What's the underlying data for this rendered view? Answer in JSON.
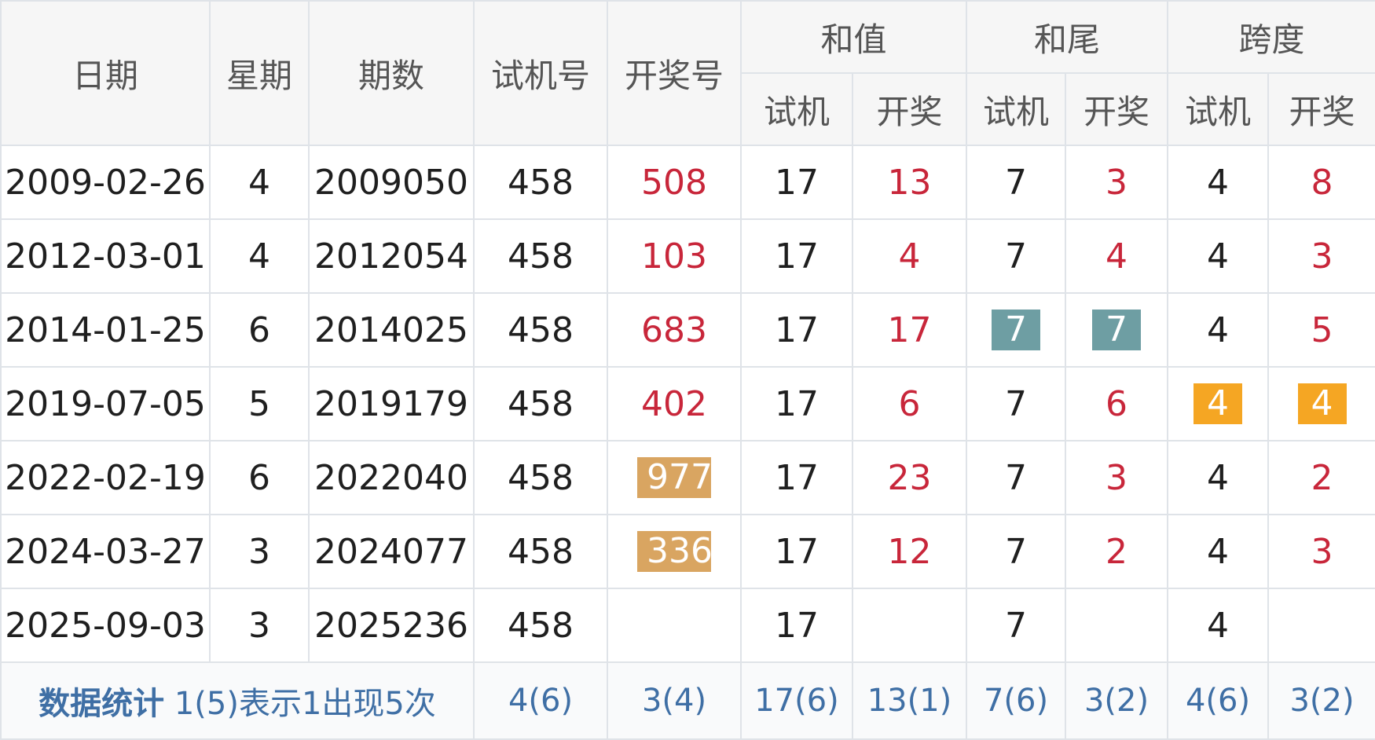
{
  "headers": {
    "date": "日期",
    "weekday": "星期",
    "issue": "期数",
    "test_num": "试机号",
    "draw_num": "开奖号",
    "sum_group": "和值",
    "tail_group": "和尾",
    "span_group": "跨度",
    "sub_test": "试机",
    "sub_draw": "开奖"
  },
  "rows": [
    {
      "date": "2009-02-26",
      "weekday": "4",
      "issue": "2009050",
      "test": "458",
      "draw": "508",
      "sum_test": "17",
      "sum_draw": "13",
      "tail_test": "7",
      "tail_draw": "3",
      "span_test": "4",
      "span_draw": "8"
    },
    {
      "date": "2012-03-01",
      "weekday": "4",
      "issue": "2012054",
      "test": "458",
      "draw": "103",
      "sum_test": "17",
      "sum_draw": "4",
      "tail_test": "7",
      "tail_draw": "4",
      "span_test": "4",
      "span_draw": "3"
    },
    {
      "date": "2014-01-25",
      "weekday": "6",
      "issue": "2014025",
      "test": "458",
      "draw": "683",
      "sum_test": "17",
      "sum_draw": "17",
      "tail_test": "7",
      "tail_draw": "7",
      "span_test": "4",
      "span_draw": "5"
    },
    {
      "date": "2019-07-05",
      "weekday": "5",
      "issue": "2019179",
      "test": "458",
      "draw": "402",
      "sum_test": "17",
      "sum_draw": "6",
      "tail_test": "7",
      "tail_draw": "6",
      "span_test": "4",
      "span_draw": "4"
    },
    {
      "date": "2022-02-19",
      "weekday": "6",
      "issue": "2022040",
      "test": "458",
      "draw": "977",
      "sum_test": "17",
      "sum_draw": "23",
      "tail_test": "7",
      "tail_draw": "3",
      "span_test": "4",
      "span_draw": "2"
    },
    {
      "date": "2024-03-27",
      "weekday": "3",
      "issue": "2024077",
      "test": "458",
      "draw": "336",
      "sum_test": "17",
      "sum_draw": "12",
      "tail_test": "7",
      "tail_draw": "2",
      "span_test": "4",
      "span_draw": "3"
    },
    {
      "date": "2025-09-03",
      "weekday": "3",
      "issue": "2025236",
      "test": "458",
      "draw": "",
      "sum_test": "17",
      "sum_draw": "",
      "tail_test": "7",
      "tail_draw": "",
      "span_test": "4",
      "span_draw": ""
    }
  ],
  "stats": {
    "label": "数据统计",
    "note": "1(5)表示1出现5次",
    "test": "4(6)",
    "draw": "3(4)",
    "sum_test": "17(6)",
    "sum_draw": "13(1)",
    "tail_test": "7(6)",
    "tail_draw": "3(2)",
    "span_test": "4(6)",
    "span_draw": "3(2)"
  },
  "colors": {
    "header_bg": "#f6f6f6",
    "border": "#dfe3e8",
    "draw_red": "#c8263a",
    "badge_teal": "#6e9ea3",
    "badge_orange": "#f5a623",
    "badge_tan": "#d9a561",
    "stats_blue": "#3f6fa5"
  }
}
